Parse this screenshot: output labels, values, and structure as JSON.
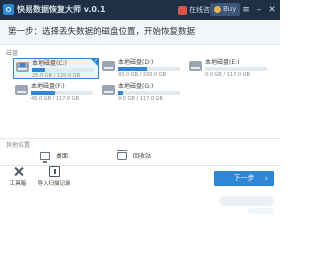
{
  "window": {
    "title": "快易数据恢复大师 v.0.1",
    "support_label": "在线咨询",
    "upgrade_label": "Buy",
    "controls": [
      "≡",
      "–",
      "✕"
    ]
  },
  "step": {
    "title": "第一步：选择丢失数据的磁盘位置，开始恢复数据"
  },
  "drives_section": {
    "label": "磁盘",
    "drives": [
      {
        "name": "本地磁盘(C:)",
        "size": "25.0 GB / 120.0 GB",
        "used_fraction": 0.21,
        "selected": true,
        "system": true
      },
      {
        "name": "本地磁盘(D:)",
        "size": "93.0 GB / 200.0 GB",
        "used_fraction": 0.47,
        "selected": false,
        "system": false
      },
      {
        "name": "本地磁盘(E:)",
        "size": "0.0 GB / 117.0 GB",
        "used_fraction": 0.0,
        "selected": false,
        "system": false
      },
      {
        "name": "本地磁盘(F:)",
        "size": "46.0 GB / 117.0 GB",
        "used_fraction": 0.39,
        "selected": false,
        "system": false
      },
      {
        "name": "本地磁盘(G:)",
        "size": "9.0 GB / 117.0 GB",
        "used_fraction": 0.08,
        "selected": false,
        "system": false
      }
    ]
  },
  "locations_section": {
    "label": "其他位置",
    "items": [
      {
        "label": "桌面"
      },
      {
        "label": "回收站"
      }
    ]
  },
  "bottom": {
    "tools_label": "工具箱",
    "import_label": "导入扫描记录",
    "next_label": "下一步",
    "next_arrow": "›"
  }
}
